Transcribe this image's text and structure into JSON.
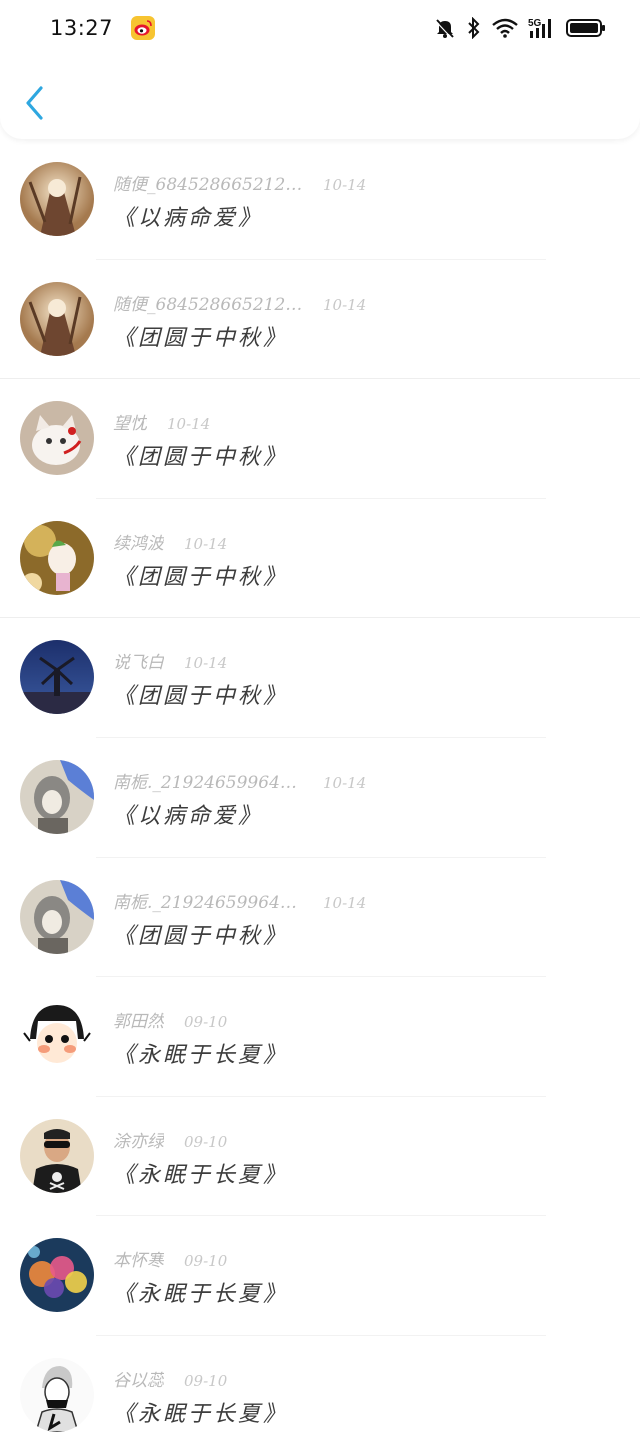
{
  "status_bar": {
    "time": "13:27",
    "network": "5G"
  },
  "colors": {
    "accent": "#2ea7e0",
    "name_text": "#b9b9b9",
    "date_text": "#c8c8c8",
    "title_text": "#3d3d3d"
  },
  "items": [
    {
      "name": "随便_6845286652126...",
      "date": "10-14",
      "title": "《以病命爱》",
      "avatar": "portrait-avatar"
    },
    {
      "name": "随便_6845286652126...",
      "date": "10-14",
      "title": "《团圆于中秋》",
      "avatar": "portrait-avatar"
    },
    {
      "name": "望忱",
      "date": "10-14",
      "title": "《团圆于中秋》",
      "avatar": "white-cat-avatar"
    },
    {
      "name": "续鸿波",
      "date": "10-14",
      "title": "《团圆于中秋》",
      "avatar": "anime-girl-avatar"
    },
    {
      "name": "说飞白",
      "date": "10-14",
      "title": "《团圆于中秋》",
      "avatar": "windmill-avatar"
    },
    {
      "name": "南栀._2192465996481...",
      "date": "10-14",
      "title": "《以病命爱》",
      "avatar": "anime-boy-avatar"
    },
    {
      "name": "南栀._2192465996481...",
      "date": "10-14",
      "title": "《团圆于中秋》",
      "avatar": "anime-boy-avatar"
    },
    {
      "name": "郭田然",
      "date": "09-10",
      "title": "《永眠于长夏》",
      "avatar": "cartoon-girl-avatar"
    },
    {
      "name": "涂亦绿",
      "date": "09-10",
      "title": "《永眠于长夏》",
      "avatar": "sunglasses-man-avatar"
    },
    {
      "name": "本怀寒",
      "date": "09-10",
      "title": "《永眠于长夏》",
      "avatar": "balloons-avatar"
    },
    {
      "name": "谷以蕊",
      "date": "09-10",
      "title": "《永眠于长夏》",
      "avatar": "sketch-avatar"
    }
  ]
}
